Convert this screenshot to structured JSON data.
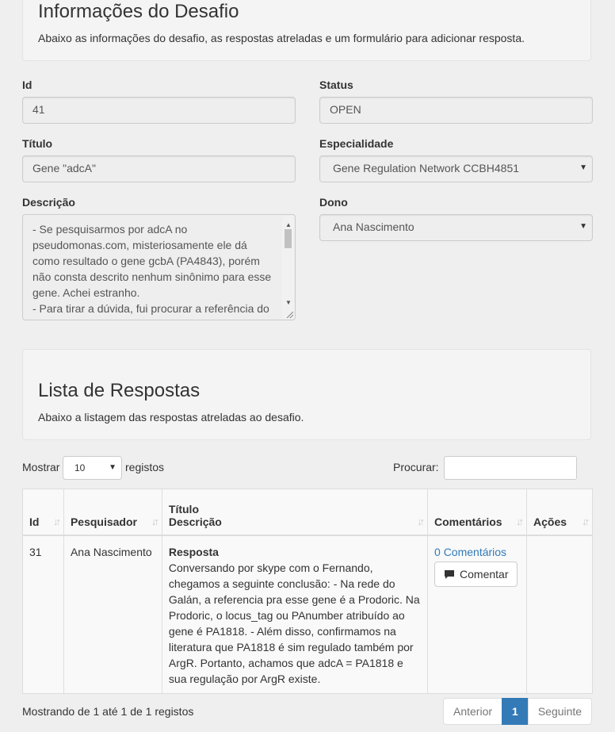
{
  "header": {
    "title": "Informações do Desafio",
    "subtitle": "Abaixo as informações do desafio, as respostas atreladas e um formulário para adicionar resposta."
  },
  "form": {
    "id_label": "Id",
    "id_value": "41",
    "status_label": "Status",
    "status_value": "OPEN",
    "titulo_label": "Título",
    "titulo_value": "Gene \"adcA\"",
    "especialidade_label": "Especialidade",
    "especialidade_value": "Gene Regulation Network CCBH4851",
    "descricao_label": "Descrição",
    "descricao_value": "- Se pesquisarmos por adcA no pseudomonas.com, misteriosamente ele dá como resultado o gene gcbA (PA4843), porém não consta descrito nenhum sinônimo para esse gene. Achei estranho.\n- Para tirar a dúvida, fui procurar a referência do Galán e na regulação Prodoric Pseudomonas",
    "dono_label": "Dono",
    "dono_value": "Ana Nascimento"
  },
  "respostas": {
    "title": "Lista de Respostas",
    "subtitle": "Abaixo a listagem das respostas atreladas ao desafio."
  },
  "table_controls": {
    "show_label": "Mostrar",
    "length_value": "10",
    "records_label": "registos",
    "search_label": "Procurar:",
    "search_value": ""
  },
  "table": {
    "headers": {
      "id": "Id",
      "pesquisador": "Pesquisador",
      "titulo": "Título",
      "descricao": "Descrição",
      "comentarios": "Comentários",
      "acoes": "Ações"
    },
    "rows": [
      {
        "id": "31",
        "pesquisador": "Ana Nascimento",
        "titulo": "Resposta",
        "descricao": "Conversando por skype com o Fernando, chegamos a seguinte conclusão: - Na rede do Galán, a referencia pra esse gene é a Prodoric. Na Prodoric, o locus_tag ou PAnumber atribuído ao gene é PA1818. - Além disso, confirmamos na literatura que PA1818 é sim regulado também por ArgR. Portanto, achamos que adcA = PA1818 e sua regulação por ArgR existe.",
        "comentarios_link": "0 Comentários",
        "comentar_label": "Comentar"
      }
    ]
  },
  "footer": {
    "info": "Mostrando de 1 até 1 de 1 registos",
    "prev_label": "Anterior",
    "current_page": "1",
    "next_label": "Seguinte"
  },
  "icons": [
    "chevron-down-icon",
    "sort-icon",
    "comment-icon"
  ],
  "colors": {
    "link": "#337ab7",
    "active_page": "#337ab7",
    "background": "#efefef"
  }
}
